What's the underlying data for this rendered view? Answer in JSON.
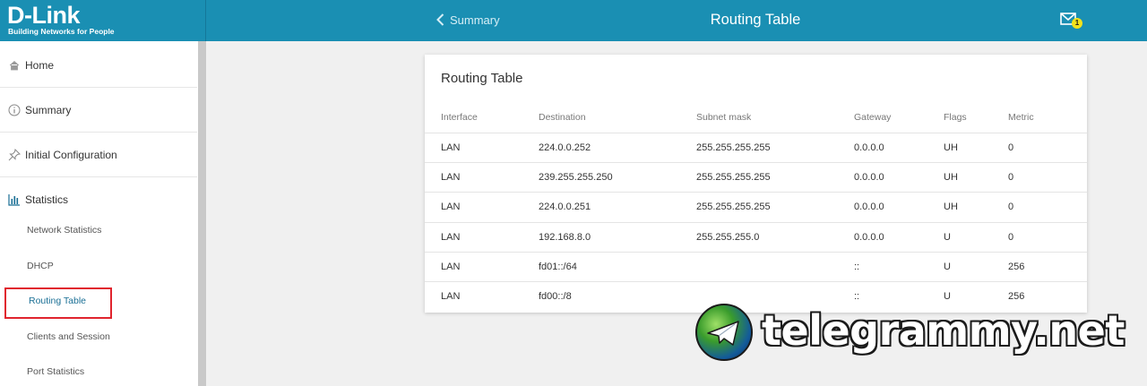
{
  "brand": {
    "name": "D-Link",
    "tagline": "Building Networks for People"
  },
  "header": {
    "back_label": "Summary",
    "title": "Routing Table",
    "notification_count": "1"
  },
  "sidebar": {
    "items": [
      {
        "label": "Home",
        "icon": "home-icon"
      },
      {
        "label": "Summary",
        "icon": "info-icon"
      },
      {
        "label": "Initial Configuration",
        "icon": "pin-icon"
      },
      {
        "label": "Statistics",
        "icon": "bar-chart-icon"
      }
    ],
    "sub_items": [
      {
        "label": "Network Statistics"
      },
      {
        "label": "DHCP"
      },
      {
        "label": "Routing Table",
        "active": true
      },
      {
        "label": "Clients and Session"
      },
      {
        "label": "Port Statistics"
      }
    ]
  },
  "card": {
    "title": "Routing Table",
    "columns": [
      "Interface",
      "Destination",
      "Subnet mask",
      "Gateway",
      "Flags",
      "Metric"
    ],
    "rows": [
      [
        "LAN",
        "224.0.0.252",
        "255.255.255.255",
        "0.0.0.0",
        "UH",
        "0"
      ],
      [
        "LAN",
        "239.255.255.250",
        "255.255.255.255",
        "0.0.0.0",
        "UH",
        "0"
      ],
      [
        "LAN",
        "224.0.0.251",
        "255.255.255.255",
        "0.0.0.0",
        "UH",
        "0"
      ],
      [
        "LAN",
        "192.168.8.0",
        "255.255.255.0",
        "0.0.0.0",
        "U",
        "0"
      ],
      [
        "LAN",
        "fd01::/64",
        "",
        "::",
        "U",
        "256"
      ],
      [
        "LAN",
        "fd00::/8",
        "",
        "::",
        "U",
        "256"
      ]
    ]
  },
  "watermark": {
    "text": "telegrammy.net"
  },
  "colors": {
    "header_bg": "#1a8fb3",
    "highlight_border": "#e0242e",
    "badge": "#f2e21c"
  }
}
